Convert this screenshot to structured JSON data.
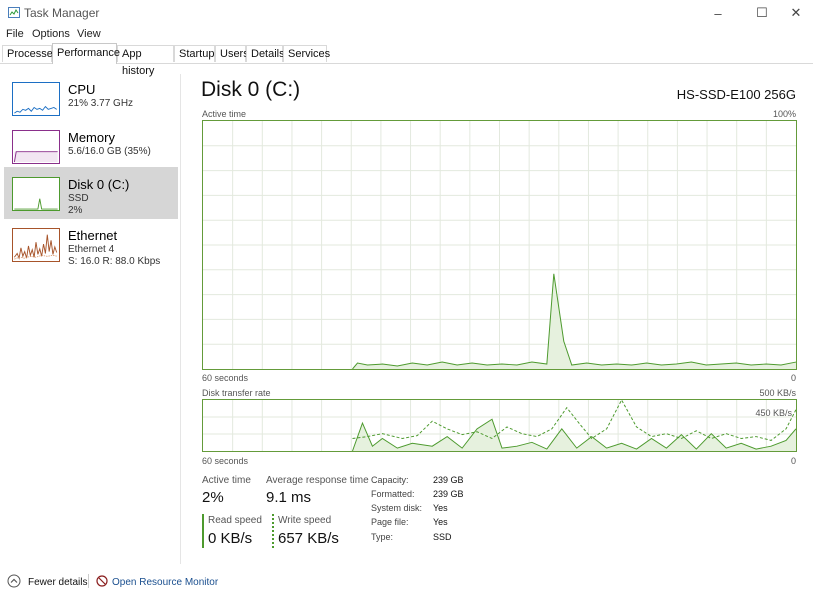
{
  "window": {
    "title": "Task Manager",
    "minimize": "–",
    "maximize": "☐",
    "close": "✕"
  },
  "menu": [
    "File",
    "Options",
    "View"
  ],
  "tabs": [
    "Processes",
    "Performance",
    "App history",
    "Startup",
    "Users",
    "Details",
    "Services"
  ],
  "active_tab": "Performance",
  "sidebar": [
    {
      "name": "CPU",
      "line1": "21%  3.77 GHz",
      "line2": ""
    },
    {
      "name": "Memory",
      "line1": "5.6/16.0 GB (35%)",
      "line2": ""
    },
    {
      "name": "Disk 0 (C:)",
      "line1": "SSD",
      "line2": "2%"
    },
    {
      "name": "Ethernet",
      "line1": "Ethernet 4",
      "line2": "S: 16.0  R: 88.0 Kbps"
    }
  ],
  "colors": {
    "cpu": "#1c6fc4",
    "memory": "#8a2f8b",
    "disk": "#4d9a2e",
    "ethernet": "#a7542a"
  },
  "main": {
    "title": "Disk 0 (C:)",
    "model": "HS-SSD-E100 256G",
    "active_graph": {
      "label": "Active time",
      "max": "100%",
      "time": "60 seconds",
      "zero": "0"
    },
    "transfer_graph": {
      "label": "Disk transfer rate",
      "max": "500 KB/s",
      "mid": "450 KB/s",
      "time": "60 seconds",
      "zero": "0"
    }
  },
  "stats": {
    "active_time_label": "Active time",
    "active_time": "2%",
    "resp_label": "Average response time",
    "resp": "9.1 ms",
    "read_label": "Read speed",
    "read": "0 KB/s",
    "write_label": "Write speed",
    "write": "657 KB/s"
  },
  "details": [
    {
      "k": "Capacity:",
      "v": "239 GB"
    },
    {
      "k": "Formatted:",
      "v": "239 GB"
    },
    {
      "k": "System disk:",
      "v": "Yes"
    },
    {
      "k": "Page file:",
      "v": "Yes"
    },
    {
      "k": "Type:",
      "v": "SSD"
    }
  ],
  "footer": {
    "fewer": "Fewer details",
    "resmon": "Open Resource Monitor"
  }
}
